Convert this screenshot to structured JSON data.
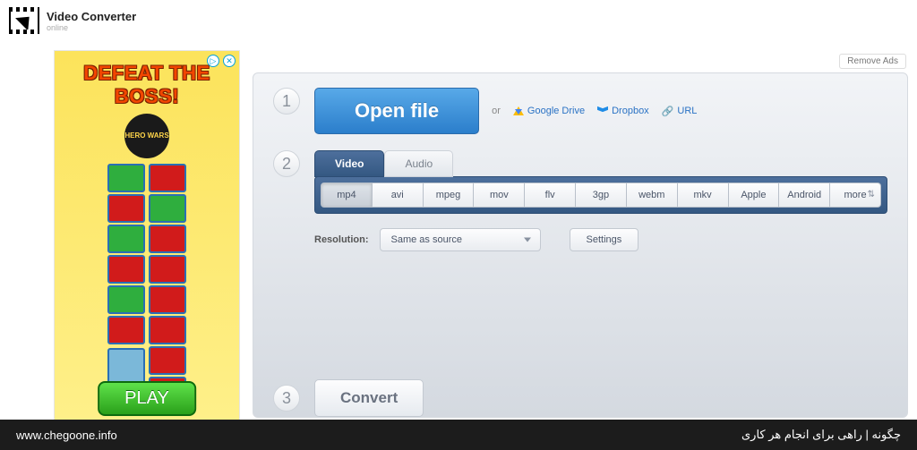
{
  "header": {
    "title": "Video Converter",
    "subtitle": "online"
  },
  "remove_ads": "Remove Ads",
  "ad": {
    "title": "DEFEAT THE BOSS!",
    "hero": "HERO WARS",
    "play": "PLAY"
  },
  "step1": {
    "number": "1",
    "open": "Open file",
    "or": "or",
    "google_drive": "Google Drive",
    "dropbox": "Dropbox",
    "url": "URL"
  },
  "step2": {
    "number": "2",
    "tab_video": "Video",
    "tab_audio": "Audio",
    "formats": [
      "mp4",
      "avi",
      "mpeg",
      "mov",
      "flv",
      "3gp",
      "webm",
      "mkv",
      "Apple",
      "Android",
      "more"
    ],
    "active_format": "mp4",
    "resolution_label": "Resolution:",
    "resolution_value": "Same as source",
    "settings": "Settings"
  },
  "step3": {
    "number": "3",
    "convert": "Convert"
  },
  "footer": {
    "left": "www.chegoone.info",
    "right": "چگونه | راهی برای انجام هر کاری"
  }
}
